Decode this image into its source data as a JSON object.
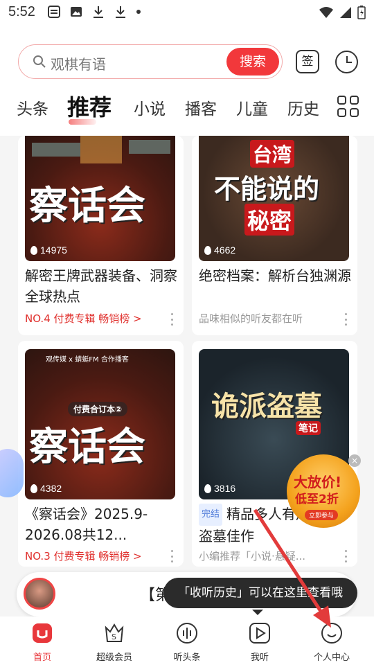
{
  "status_bar": {
    "time": "5:52"
  },
  "search": {
    "placeholder": "观棋有语",
    "button_label": "搜索"
  },
  "header_actions": {
    "sign_label": "签"
  },
  "tabs": [
    {
      "label": "头条"
    },
    {
      "label": "推荐"
    },
    {
      "label": "小说"
    },
    {
      "label": "播客"
    },
    {
      "label": "儿童"
    },
    {
      "label": "历史"
    }
  ],
  "cards": [
    {
      "cover_text": "察话会",
      "play_count": "14975",
      "title": "解密王牌武器装备、洞察全球热点",
      "subtitle": "NO.4 付费专辑 畅销榜 >"
    },
    {
      "cover_text_1": "台湾",
      "cover_text_2": "不能说的",
      "cover_text_3": "秘密",
      "play_count": "4662",
      "title": "绝密档案：解析台独渊源",
      "subtitle": "品味相似的听友都在听"
    },
    {
      "cover_top": "观传媒 x 蜻蜓FM 合作播客",
      "cover_badge": "付费合订本②",
      "cover_text": "察话会",
      "play_count": "4382",
      "title": "《察话会》2025.9-2026.08共12...",
      "subtitle": "NO.3 付费专辑 畅销榜 >"
    },
    {
      "cover_text": "诡派盗墓",
      "cover_sub": "笔记",
      "play_count": "3816",
      "tag": "完结",
      "title": "精品多人有声 悬疑盗墓佳作",
      "subtitle": "小编推荐「小说·悬疑..."
    }
  ],
  "promo": {
    "line1": "大放价!",
    "line2": "低至2折",
    "cta": "立即参与"
  },
  "player": {
    "now_playing": "【第376期】察话会"
  },
  "tooltip": {
    "text": "「收听历史」可以在这里查看哦"
  },
  "nav": [
    {
      "label": "首页"
    },
    {
      "label": "超级会员"
    },
    {
      "label": "听头条"
    },
    {
      "label": "我听"
    },
    {
      "label": "个人中心"
    }
  ],
  "colors": {
    "accent": "#f2383b",
    "rank_text": "#e0302d",
    "arrow": "#e23b3b"
  }
}
